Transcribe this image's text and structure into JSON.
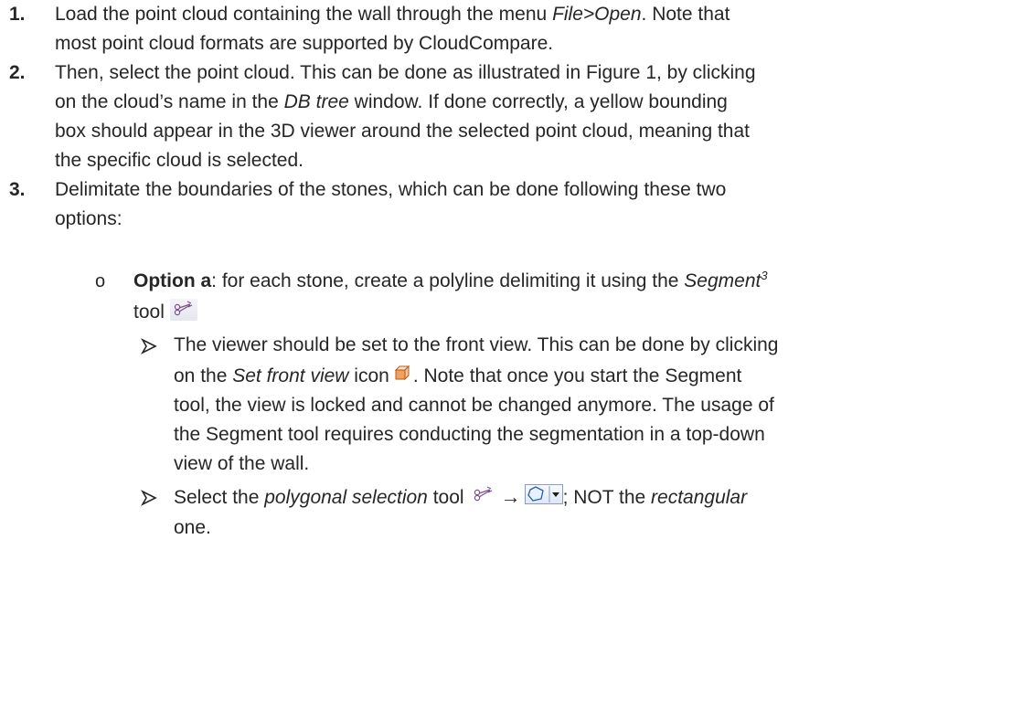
{
  "steps": {
    "s1": {
      "number": "1.",
      "line1_a": "Load the point cloud containing the wall through the menu ",
      "line1_menu": "File>Open",
      "line1_b": ". Note that",
      "line2": "most point cloud formats are supported by CloudCompare."
    },
    "s2": {
      "number": "2.",
      "line1": "Then, select the point cloud. This can be done as illustrated in Figure 1, by clicking",
      "line2_a": "on the cloud’s name in the ",
      "line2_window": "DB tree",
      "line2_b": " window. If done correctly, a yellow bounding",
      "line3": "box should appear in the 3D viewer around the selected point cloud, meaning that",
      "line4": "the specific cloud is selected."
    },
    "s3": {
      "number": "3.",
      "line1": "Delimitate the boundaries of the stones, which can be done following these two",
      "line2": "options:"
    }
  },
  "option_a": {
    "bullet": "o",
    "label": "Option a",
    "text_a": ": for each stone, create a polyline delimiting it using the ",
    "tool_name": "Segment",
    "footnote": "3",
    "line2": "tool",
    "icon": "scissors-icon"
  },
  "sub1": {
    "line1": "The viewer should be set to the front view. This can be done by clicking",
    "line2_a": "on the ",
    "line2_icon_name": "Set front view",
    "line2_b": " icon",
    "line2_c": ". Note that once you start the Segment",
    "line3": "tool, the view is locked and cannot be changed anymore. The usage of",
    "line4": "the Segment tool requires conducting the segmentation in a top-down",
    "line5": "view of the wall.",
    "icon": "cube-icon"
  },
  "sub2": {
    "line1_a": "Select the ",
    "line1_tool": "polygonal selection",
    "line1_b": " tool",
    "line1_c": "; NOT the ",
    "line1_alt": "rectangular",
    "line2": "one.",
    "arrow": "→",
    "icons": [
      "scissors-icon",
      "polygon-selection-icon"
    ]
  }
}
